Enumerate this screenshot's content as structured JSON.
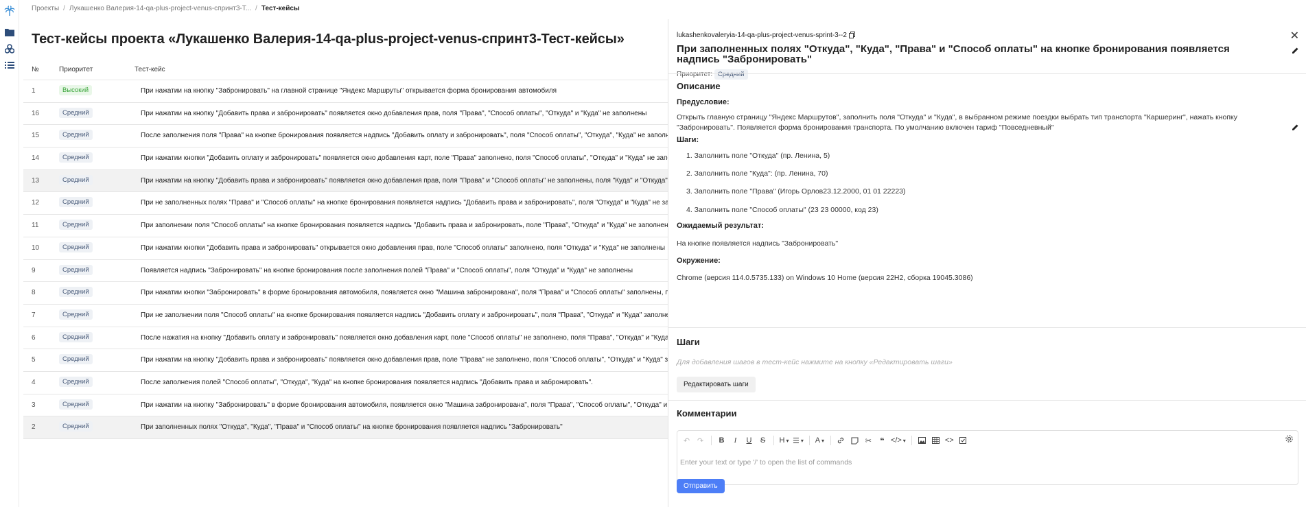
{
  "breadcrumbs": [
    "Проекты",
    "Лукашенко Валерия-14-qa-plus-project-venus-спринт3-Т...",
    "Тест-кейсы"
  ],
  "page_title": "Тест-кейсы проекта «Лукашенко Валерия-14-qa-plus-project-venus-спринт3-Тест-кейсы»",
  "table": {
    "headers": {
      "id": "№",
      "priority": "Приоритет",
      "case": "Тест-кейс"
    },
    "rows": [
      {
        "id": "1",
        "priority": "Высокий",
        "text": "При нажатии на кнопку \"Забронировать\" на главной странице \"Яндекс Маршруты\" открывается форма бронирования автомобиля"
      },
      {
        "id": "16",
        "priority": "Средний",
        "text": "При нажатии на кнопку \"Добавить права и забронировать\" появляется окно добавления прав, поля \"Права\", \"Способ оплаты\", \"Откуда\" и \"Куда\" не заполнены"
      },
      {
        "id": "15",
        "priority": "Средний",
        "text": "После заполнения поля \"Права\" на кнопке бронирования появляется надпись \"Добавить оплату и забронировать\", поля \"Способ оплаты\", \"Откуда\", \"Куда\" не заполнены"
      },
      {
        "id": "14",
        "priority": "Средний",
        "text": "При нажатии кнопки \"Добавить оплату и забронировать\" появляется окно добавления карт, поле \"Права\" заполнено, поля \"Способ оплаты\", \"Откуда\" и \"Куда\" не заполнены"
      },
      {
        "id": "13",
        "priority": "Средний",
        "text": "При нажатии на кнопку \"Добавить права и забронировать\" появляется окно добавления прав, поля \"Права\" и \"Способ оплаты\" не заполнены, поля \"Куда\" и \"Откуда\" заполнены"
      },
      {
        "id": "12",
        "priority": "Средний",
        "text": "При не заполненных полях \"Права\" и \"Способ оплаты\" на кнопке бронирования появляется надпись \"Добавить права и забронировать\", поля \"Откуда\" и \"Куда\" не заполнены"
      },
      {
        "id": "11",
        "priority": "Средний",
        "text": "При заполнении поля \"Способ оплаты\" на кнопке бронирования появляется надпись \"Добавить права и забронировать, поле \"Права\", \"Откуда\" и \"Куда\" не заполнены"
      },
      {
        "id": "10",
        "priority": "Средний",
        "text": "При нажатии кнопки \"Добавить права и забронировать\" открывается окно добавления прав, поле \"Способ оплаты\" заполнено, поля \"Откуда\" и \"Куда\" не заполнены"
      },
      {
        "id": "9",
        "priority": "Средний",
        "text": "Появляется надпись \"Забронировать\" на кнопке бронирования после заполнения полей \"Права\" и \"Способ оплаты\", поля \"Откуда\" и \"Куда\" не заполнены"
      },
      {
        "id": "8",
        "priority": "Средний",
        "text": "При нажатии кнопки \"Забронировать\" в форме бронирования автомобиля, появляется окно \"Машина забронирована\", поля \"Права\" и \"Способ оплаты\" заполнены, поля \"Откуда\" и \"Куда\" не заполнены"
      },
      {
        "id": "7",
        "priority": "Средний",
        "text": "При не заполнении поля \"Способ оплаты\" на кнопке бронирования появляется надпись \"Добавить оплату и забронировать\", поля \"Права\", \"Откуда\" и \"Куда\" заполнены"
      },
      {
        "id": "6",
        "priority": "Средний",
        "text": "После нажатия на кнопку \"Добавить оплату и забронировать\" появляется окно добавления карт, поле \"Способ оплаты\" не заполнено, поля \"Права\", \"Откуда\" и \"Куда\" заполнены"
      },
      {
        "id": "5",
        "priority": "Средний",
        "text": "При нажатии на кнопку \"Добавить права и забронировать\" появляется окно добавления прав, поле \"Права\" не заполнено, поля \"Способ оплаты\", \"Откуда\" и \"Куда\" заполнены"
      },
      {
        "id": "4",
        "priority": "Средний",
        "text": "После заполнения полей \"Способ оплаты\", \"Откуда\", \"Куда\" на кнопке бронирования появляется надпись \"Добавить права и забронировать\"."
      },
      {
        "id": "3",
        "priority": "Средний",
        "text": "При нажатии на кнопку \"Забронировать\" в форме бронирования автомобиля, появляется окно \"Машина забронирована\", поля \"Права\", \"Способ оплаты\", \"Откуда\" и \"Куда\" заполнены"
      },
      {
        "id": "2",
        "priority": "Средний",
        "text": "При заполненных полях \"Откуда\", \"Куда\", \"Права\" и \"Способ оплаты\" на кнопке бронирования появляется надпись \"Забронировать\""
      }
    ]
  },
  "panel": {
    "key": "lukashenkovaleryia-14-qa-plus-project-venus-sprint-3--2",
    "title": "При заполненных полях \"Откуда\", \"Куда\", \"Права\" и \"Способ оплаты\" на кнопке бронирования появляется надпись \"Забронировать\"",
    "priority_label": "Приоритет:",
    "priority_value": "Средний",
    "description_heading": "Описание",
    "precondition_label": "Предусловие:",
    "precondition_text": "Открыть главную страницу \"Яндекс Маршрутов\", заполнить поля \"Откуда\" и \"Куда\", в выбранном режиме поездки выбрать тип транспорта \"Каршеринг\", нажать кнопку \"Забронировать\". Появляется форма бронирования транспорта. По умолчанию включен тариф \"Повседневный\"",
    "steps_label": "Шаги:",
    "steps": [
      "1. Заполнить поле \"Откуда\" (пр. Ленина, 5)",
      "2. Заполнить поле \"Куда\": (пр. Ленина, 70)",
      "3. Заполнить поле \"Права\" (Игорь Орлов23.12.2000, 01 01 22223)",
      "4. Заполнить поле \"Способ оплаты\" (23 23 00000, код 23)"
    ],
    "expected_label": "Ожидаемый результат:",
    "expected_text": "На кнопке появляется надпись \"Забронировать\"",
    "env_label": "Окружение:",
    "env_text": "Chrome (версия 114.0.5735.133) on Windows 10 Home (версия 22H2, сборка 19045.3086)",
    "steps_heading": "Шаги",
    "steps_hint": "Для добавления шагов в тест-кейс нажмите на кнопку «Редактировать шаги»",
    "edit_steps_button": "Редактировать шаги",
    "comments_heading": "Комментарии",
    "editor_placeholder": "Enter your text or type '/' to open the list of commands",
    "toolbar": {
      "heading": "H",
      "text": "A"
    },
    "send_button": "Отправить"
  },
  "colors": {
    "accent": "#4d7ef7",
    "high_priority": "#3aa53a",
    "logo": "#3b8fd6"
  }
}
